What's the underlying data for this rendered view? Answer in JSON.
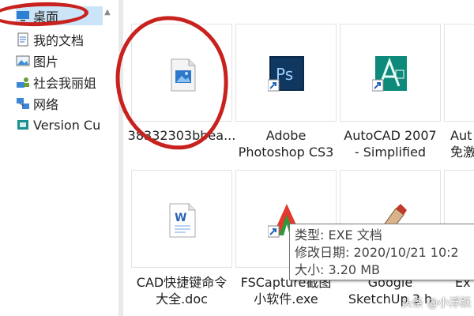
{
  "sidebar": {
    "items": [
      {
        "label": "桌面",
        "icon": "desktop-icon",
        "selected": true
      },
      {
        "label": "我的文档",
        "icon": "documents-icon"
      },
      {
        "label": "图片",
        "icon": "pictures-icon"
      },
      {
        "label": "社会我丽姐",
        "icon": "user-network-icon"
      },
      {
        "label": "网络",
        "icon": "network-icon"
      },
      {
        "label": "Version Cu",
        "icon": "version-cue-icon"
      }
    ]
  },
  "files": [
    {
      "name_lines": [
        "38332303bbea..."
      ],
      "icon": "image-file-icon"
    },
    {
      "name_lines": [
        "Adobe",
        "Photoshop CS3"
      ],
      "icon": "photoshop-icon"
    },
    {
      "name_lines": [
        "AutoCAD 2007",
        "- Simplified"
      ],
      "icon": "autocad-icon"
    },
    {
      "name_lines": [
        "Aut",
        "免激"
      ],
      "icon": "autocad-partial-icon"
    },
    {
      "name_lines": [
        "CAD快捷键命令",
        "大全.doc"
      ],
      "icon": "word-doc-icon"
    },
    {
      "name_lines": [
        "FSCapture截图",
        "小软件.exe"
      ],
      "icon": "fscapture-icon"
    },
    {
      "name_lines": [
        "Google",
        "SketchUp 3 h"
      ],
      "icon": "sketchup-icon"
    },
    {
      "name_lines": [
        "",
        "Ex"
      ],
      "icon": "partial-icon"
    }
  ],
  "tooltip": {
    "type": "类型: EXE 文档",
    "modified": "修改日期: 2020/10/21 10:2",
    "size": "大小: 3.20 MB"
  },
  "watermark": "头条 @小浮跃",
  "colors": {
    "annotation": "#c8221f",
    "selection": "#cce4f7",
    "photoshop": "#0b2a4a",
    "autocad": "#0e8a7a"
  }
}
